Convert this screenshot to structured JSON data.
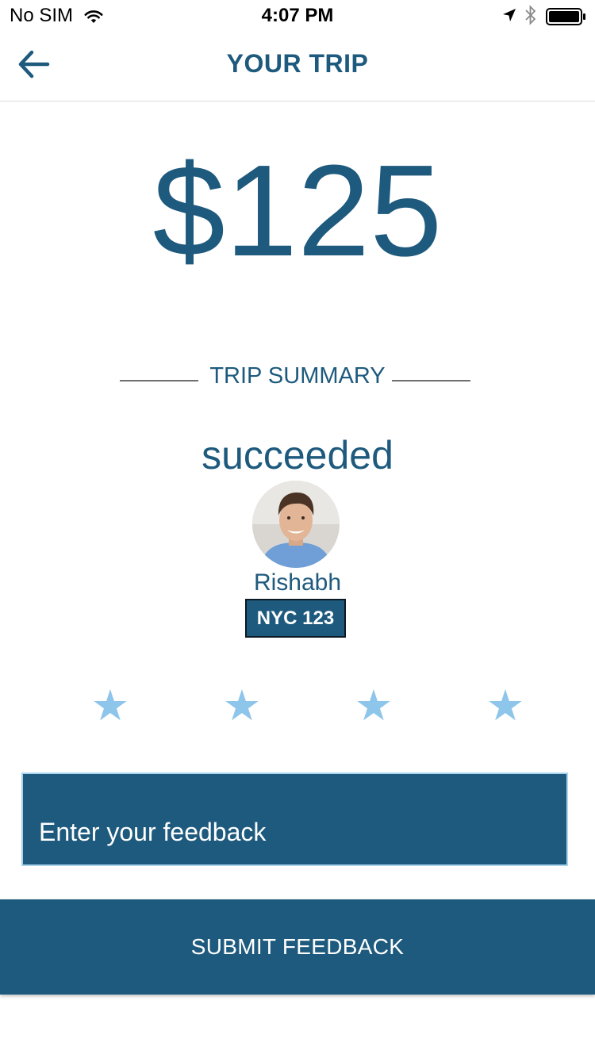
{
  "status_bar": {
    "carrier": "No SIM",
    "time": "4:07 PM",
    "icons": [
      "wifi-icon",
      "location-arrow-icon",
      "bluetooth-icon",
      "battery-icon"
    ]
  },
  "nav": {
    "title": "YOUR TRIP",
    "back_icon": "arrow-left-icon"
  },
  "trip": {
    "price": "$125",
    "summary_title": "TRIP SUMMARY",
    "status": "succeeded"
  },
  "driver": {
    "name": "Rishabh",
    "plate": "NYC 123"
  },
  "rating": {
    "stars": [
      "★",
      "★",
      "★",
      "★"
    ]
  },
  "feedback": {
    "placeholder": "Enter your feedback",
    "value": ""
  },
  "submit": {
    "label": "SUBMIT FEEDBACK"
  },
  "colors": {
    "primary": "#1e5a7d",
    "star": "#8ec5ea",
    "feedback_border": "#a9d4ee"
  }
}
